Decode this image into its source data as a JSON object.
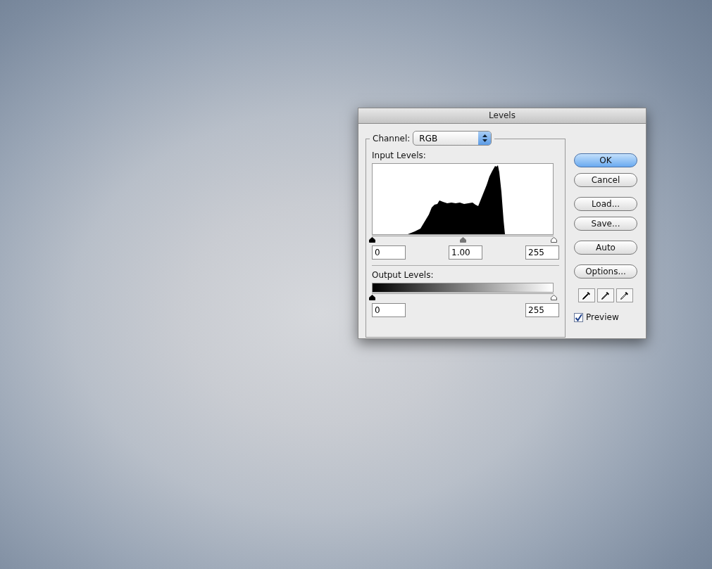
{
  "dialog": {
    "title": "Levels",
    "channel": {
      "label": "Channel:",
      "value": "RGB"
    },
    "input_levels": {
      "label": "Input Levels:",
      "handles": [
        {
          "level": 0,
          "kind": "black"
        },
        {
          "level": 0.5,
          "kind": "gray"
        },
        {
          "level": 1,
          "kind": "white"
        }
      ],
      "fields": [
        "0",
        "1.00",
        "255"
      ]
    },
    "output_levels": {
      "label": "Output Levels:",
      "handles": [
        {
          "level": 0,
          "kind": "black"
        },
        {
          "level": 1,
          "kind": "white"
        }
      ],
      "fields": [
        "0",
        "255"
      ]
    },
    "button_groups": [
      [
        {
          "label": "OK",
          "default": true
        },
        {
          "label": "Cancel",
          "default": false
        }
      ],
      [
        {
          "label": "Load...",
          "default": false
        },
        {
          "label": "Save...",
          "default": false
        }
      ],
      [
        {
          "label": "Auto",
          "default": false
        }
      ],
      [
        {
          "label": "Options...",
          "default": false
        }
      ]
    ],
    "eyedroppers": [
      {
        "kind": "black"
      },
      {
        "kind": "gray"
      },
      {
        "kind": "white"
      }
    ],
    "preview": {
      "label": "Preview",
      "checked": true
    }
  }
}
